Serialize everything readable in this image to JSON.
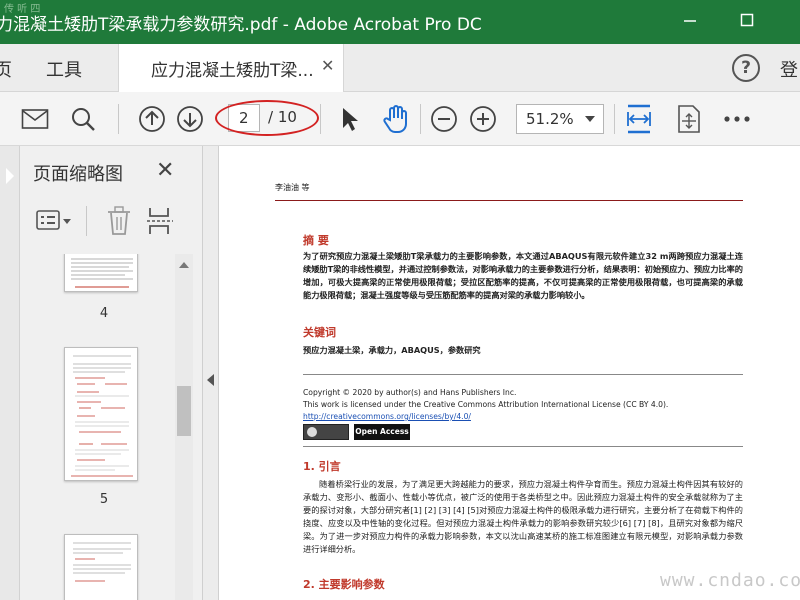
{
  "window": {
    "title": "力混凝土矮肋T梁承载力参数研究.pdf - Adobe Acrobat Pro DC",
    "corner_mark": "传 听 四",
    "colors": {
      "titlebar": "#1f7a3a",
      "accent": "#1f6fd1",
      "highlight_oval": "#d32222"
    }
  },
  "tabs": {
    "home": "页",
    "tools": "工具",
    "document_tab": "应力混凝土矮肋T梁...",
    "signin": "登"
  },
  "toolbar": {
    "current_page": "2",
    "total_pages": "/ 10",
    "zoom": "51.2%"
  },
  "left_panel": {
    "title": "页面缩略图",
    "thumbnails": [
      {
        "label": "4"
      },
      {
        "label": "5"
      }
    ]
  },
  "document": {
    "author": "李油油  等",
    "abstract_heading": "摘  要",
    "abstract_text": "为了研究预应力混凝土梁矮肋T梁承载力的主要影响参数，本文通过ABAQUS有限元软件建立32 m两跨预应力混凝土连续矮肋T梁的非线性模型，并通过控制参数法，对影响承载力的主要参数进行分析，结果表明：初始预应力、预应力比率的增加，可极大提高梁的正常使用极限荷载；受拉区配筋率的提高，不仅可提高梁的正常使用极限荷载，也可提高梁的承载能力极限荷载；混凝土强度等级与受压筋配筋率的提高对梁的承载力影响较小。",
    "keywords_heading": "关键词",
    "keywords_text": "预应力混凝土梁，承载力，ABAQUS，参数研究",
    "copyright_line1": "Copyright © 2020 by author(s) and Hans Publishers Inc.",
    "copyright_line2": "This work is licensed under the Creative Commons Attribution International License (CC BY 4.0).",
    "license_link": "http://creativecommons.org/licenses/by/4.0/",
    "open_access": "Open Access",
    "intro_heading": "1. 引言",
    "intro_text": "随着桥梁行业的发展，为了满足更大跨越能力的要求，预应力混凝土构件孕育而生。预应力混凝土构件因其有较好的承载力、变形小、截面小、性载小等优点，被广泛的使用于各类桥型之中。因此预应力混凝土构件的安全承载就称为了主要的探讨对象，大部分研究者[1] [2] [3] [4] [5]对预应力混凝土构件的极限承载力进行研究，主要分析了在荷载下构件的挠度、应变以及中性轴的变化过程。但对预应力混凝土构件承载力的影响参数研究较少[6] [7] [8]，且研究对象都为缩尺梁。为了进一步对预应力构件的承载力影响参数，本文以沈山高速某桥的施工标准图建立有限元模型，对影响承载力参数进行详细分析。",
    "section2_heading": "2. 主要影响参数"
  },
  "watermark": "www.cndao.com"
}
